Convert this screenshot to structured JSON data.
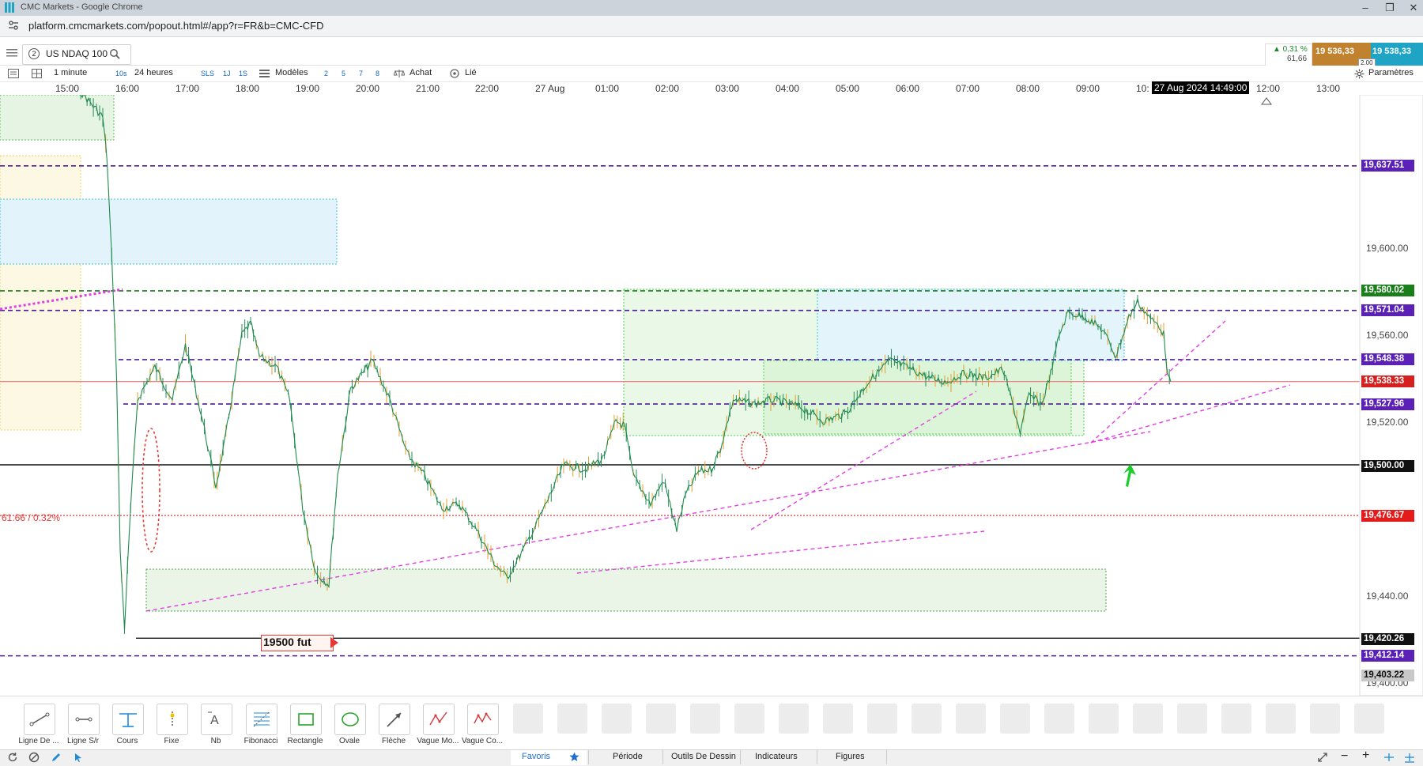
{
  "window": {
    "title": "CMC Markets - Google Chrome",
    "url": "platform.cmcmarkets.com/popout.html#/app?r=FR&b=CMC-CFD"
  },
  "instrument": {
    "badge": "2",
    "name": "US NDAQ 100",
    "change_pct": "▲ 0,31 %",
    "change_abs": "61,66",
    "sell_price": "19 536,33",
    "buy_price": "19 538,33",
    "spread": "2.00"
  },
  "toolbar": {
    "interval": "1 minute",
    "btn_10s": "10s",
    "range": "24 heures",
    "btn_sls": "SLS",
    "btn_1j": "1J",
    "btn_1s": "1S",
    "modeles": "Modèles",
    "n2": "2",
    "n5": "5",
    "n7": "7",
    "n8": "8",
    "achat": "Achat",
    "lie": "Lié",
    "parametres": "Paramètres"
  },
  "time_axis": {
    "labels": [
      "15:00",
      "16:00",
      "17:00",
      "18:00",
      "19:00",
      "20:00",
      "21:00",
      "22:00",
      "27 Aug",
      "01:00",
      "02:00",
      "03:00",
      "04:00",
      "05:00",
      "06:00",
      "07:00",
      "08:00",
      "09:00",
      "10:",
      "12:00",
      "13:00"
    ],
    "cursor": "27 Aug 2024 14:49:00"
  },
  "chart_data": {
    "type": "candlestick",
    "instrument": "US NDAQ 100",
    "interval": "1 minute",
    "x_range": [
      "26 Aug 14:35",
      "27 Aug 13:30"
    ],
    "ylim": [
      19400,
      19650
    ],
    "price_ticks": [
      "19,600.00",
      "19,560.00",
      "19,520.00",
      "19,440.00",
      "19,400.00"
    ],
    "horizontal_levels": [
      {
        "value": 19637.51,
        "label": "19,637.51",
        "style": "purple-dashed"
      },
      {
        "value": 19580.02,
        "label": "19,580.02",
        "style": "green-dashed"
      },
      {
        "value": 19571.04,
        "label": "19,571.04",
        "style": "purple-dashed"
      },
      {
        "value": 19548.38,
        "label": "19,548.38",
        "style": "purple-dashed"
      },
      {
        "value": 19538.33,
        "label": "19,538.33",
        "style": "current-price"
      },
      {
        "value": 19527.96,
        "label": "19,527.96",
        "style": "purple-dashed"
      },
      {
        "value": 19500.0,
        "label": "19,500.00",
        "style": "black-solid"
      },
      {
        "value": 19476.67,
        "label": "19,476.67",
        "style": "red-dotted"
      },
      {
        "value": 19420.26,
        "label": "19,420.26",
        "style": "black-solid"
      },
      {
        "value": 19412.14,
        "label": "19,412.14",
        "style": "purple-dashed"
      },
      {
        "value": 19403.22,
        "label": "19,403.22",
        "style": "grey"
      }
    ],
    "annotations": {
      "ref_change": "61.66 / 0.32%",
      "note": "19500 fut"
    },
    "price_path": [
      [
        "26 Aug 14:35",
        19690
      ],
      [
        "15:40",
        19660
      ],
      [
        "15:45",
        19640
      ],
      [
        "15:52",
        19580
      ],
      [
        "15:56",
        19540
      ],
      [
        "16:00",
        19460
      ],
      [
        "16:05",
        19425
      ],
      [
        "16:12",
        19480
      ],
      [
        "16:20",
        19530
      ],
      [
        "16:40",
        19545
      ],
      [
        "17:00",
        19530
      ],
      [
        "17:15",
        19555
      ],
      [
        "17:35",
        19520
      ],
      [
        "17:50",
        19490
      ],
      [
        "18:00",
        19510
      ],
      [
        "18:10",
        19535
      ],
      [
        "18:20",
        19560
      ],
      [
        "18:30",
        19565
      ],
      [
        "18:40",
        19550
      ],
      [
        "19:00",
        19545
      ],
      [
        "19:15",
        19530
      ],
      [
        "19:30",
        19480
      ],
      [
        "19:45",
        19450
      ],
      [
        "20:00",
        19445
      ],
      [
        "20:10",
        19495
      ],
      [
        "20:25",
        19535
      ],
      [
        "20:50",
        19548
      ],
      [
        "21:10",
        19530
      ],
      [
        "21:30",
        19505
      ],
      [
        "21:50",
        19495
      ],
      [
        "22:10",
        19480
      ],
      [
        "22:30",
        19482
      ],
      [
        "22:50",
        19470
      ],
      [
        "23:10",
        19455
      ],
      [
        "23:25",
        19448
      ],
      [
        "23:45",
        19462
      ],
      [
        "00:05",
        19478
      ],
      [
        "00:30",
        19500
      ],
      [
        "00:55",
        19498
      ],
      [
        "01:15",
        19503
      ],
      [
        "01:30",
        19520
      ],
      [
        "01:40",
        19518
      ],
      [
        "01:50",
        19495
      ],
      [
        "02:10",
        19482
      ],
      [
        "02:25",
        19493
      ],
      [
        "02:40",
        19470
      ],
      [
        "02:50",
        19486
      ],
      [
        "03:05",
        19497
      ],
      [
        "03:20",
        19498
      ],
      [
        "03:30",
        19507
      ],
      [
        "03:45",
        19530
      ],
      [
        "04:10",
        19528
      ],
      [
        "04:30",
        19530
      ],
      [
        "05:00",
        19527
      ],
      [
        "05:30",
        19520
      ],
      [
        "05:55",
        19524
      ],
      [
        "06:20",
        19538
      ],
      [
        "06:45",
        19548
      ],
      [
        "07:10",
        19544
      ],
      [
        "07:30",
        19540
      ],
      [
        "07:50",
        19538
      ],
      [
        "08:10",
        19542
      ],
      [
        "08:35",
        19540
      ],
      [
        "08:55",
        19544
      ],
      [
        "09:05",
        19530
      ],
      [
        "09:15",
        19515
      ],
      [
        "09:25",
        19532
      ],
      [
        "09:40",
        19528
      ],
      [
        "09:50",
        19542
      ],
      [
        "10:00",
        19560
      ],
      [
        "10:10",
        19570
      ],
      [
        "10:30",
        19568
      ],
      [
        "10:50",
        19562
      ],
      [
        "11:05",
        19550
      ],
      [
        "11:20",
        19568
      ],
      [
        "11:30",
        19575
      ],
      [
        "11:45",
        19567
      ],
      [
        "11:55",
        19564
      ],
      [
        "12:00",
        19560
      ],
      [
        "12:05",
        19540
      ],
      [
        "12:08",
        19538.33
      ]
    ]
  },
  "drawing_tools": [
    "Ligne De ...",
    "Ligne S/r",
    "Cours",
    "Fixe",
    "Nb",
    "Fibonacci",
    "Rectangle",
    "Ovale",
    "Flèche",
    "Vague Mo...",
    "Vague Co..."
  ],
  "bottom_tabs": {
    "favoris": "Favoris",
    "periode": "Période",
    "outils": "Outils De Dessin",
    "indicateurs": "Indicateurs",
    "figures": "Figures"
  },
  "colors": {
    "accent": "#1fa4c6",
    "sell": "#c0822f",
    "current_price": "#d62020",
    "level_purple": "#5b21b6",
    "trend_magenta": "#e040e0"
  }
}
